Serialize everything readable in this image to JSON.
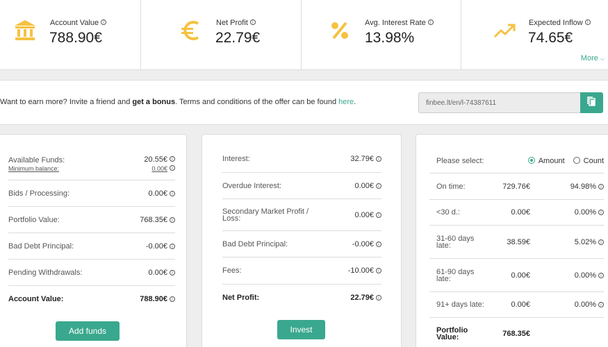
{
  "stats": [
    {
      "label": "Account Value",
      "value": "788.90€",
      "icon": "bank-icon"
    },
    {
      "label": "Net Profit",
      "value": "22.79€",
      "icon": "euro-icon"
    },
    {
      "label": "Avg. Interest Rate",
      "value": "13.98%",
      "icon": "percent-icon"
    },
    {
      "label": "Expected Inflow",
      "value": "74.65€",
      "icon": "trend-up-icon"
    }
  ],
  "more_label": "More",
  "referral": {
    "text_before": "Want to earn more? Invite a friend and ",
    "bold": "get a bonus",
    "text_after": ". Terms and conditions of the offer can be found ",
    "link": "here",
    "end": ".",
    "url": "finbee.lt/en/l-74387611"
  },
  "balance_card": {
    "rows": [
      {
        "label": "Available Funds:",
        "value": "20.55€",
        "sub_label": "Minimum balance:",
        "sub_value": "0.00€"
      },
      {
        "label": "Bids / Processing:",
        "value": "0.00€"
      },
      {
        "label": "Portfolio Value:",
        "value": "768.35€"
      },
      {
        "label": "Bad Debt Principal:",
        "value": "-0.00€"
      },
      {
        "label": "Pending Withdrawals:",
        "value": "0.00€"
      },
      {
        "label": "Account Value:",
        "value": "788.90€"
      }
    ],
    "button": "Add funds"
  },
  "profit_card": {
    "rows": [
      {
        "label": "Interest:",
        "value": "32.79€"
      },
      {
        "label": "Overdue Interest:",
        "value": "0.00€"
      },
      {
        "label": "Secondary Market Profit / Loss:",
        "value": "0.00€"
      },
      {
        "label": "Bad Debt Principal:",
        "value": "-0.00€"
      },
      {
        "label": "Fees:",
        "value": "-10.00€"
      },
      {
        "label": "Net Profit:",
        "value": "22.79€"
      }
    ],
    "button": "Invest"
  },
  "portfolio_card": {
    "select_label": "Please select:",
    "option_amount": "Amount",
    "option_count": "Count",
    "selected": "Amount",
    "rows": [
      {
        "label": "On time:",
        "amount": "729.76€",
        "percent": "94.98%"
      },
      {
        "label": "<30 d.:",
        "amount": "0.00€",
        "percent": "0.00%"
      },
      {
        "label": "31-60 days late:",
        "amount": "38.59€",
        "percent": "5.02%"
      },
      {
        "label": "61-90 days late:",
        "amount": "0.00€",
        "percent": "0.00%"
      },
      {
        "label": "91+ days late:",
        "amount": "0.00€",
        "percent": "0.00%"
      },
      {
        "label": "Portfolio Value:",
        "amount": "768.35€"
      }
    ]
  },
  "colors": {
    "accent": "#3aa88e",
    "icon_yellow": "#f5c242"
  }
}
